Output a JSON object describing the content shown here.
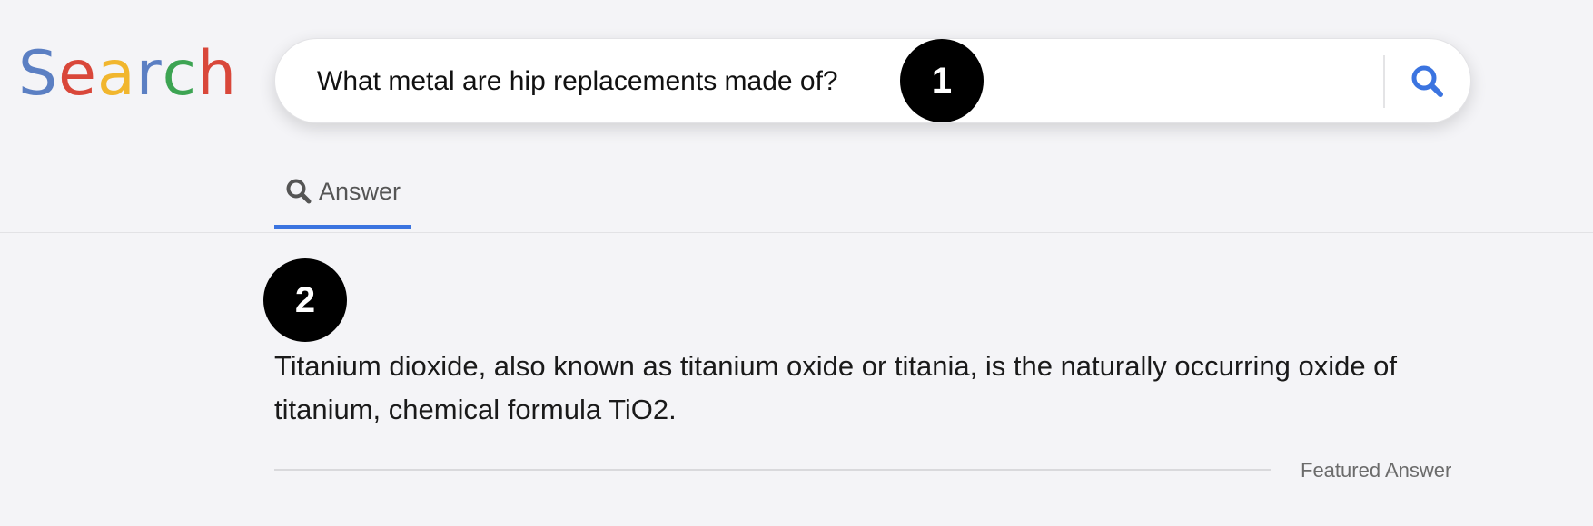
{
  "logo": {
    "letters": [
      {
        "char": "S",
        "color": "#5b7fc3"
      },
      {
        "char": "e",
        "color": "#d9473a"
      },
      {
        "char": "a",
        "color": "#f1b62e"
      },
      {
        "char": "r",
        "color": "#5b7fc3"
      },
      {
        "char": "c",
        "color": "#3da453"
      },
      {
        "char": "h",
        "color": "#d9473a"
      }
    ]
  },
  "search": {
    "query": "What metal are hip replacements made of?",
    "button_icon": "search-icon",
    "accent_color": "#3b74e0"
  },
  "markers": {
    "first": "1",
    "second": "2"
  },
  "tabs": {
    "answer": {
      "label": "Answer",
      "icon": "search-icon",
      "active": true
    }
  },
  "answer": {
    "text": "Titanium dioxide, also known as titanium oxide or titania, is the naturally occurring oxide of titanium, chemical formula TiO2.",
    "footer_label": "Featured Answer"
  }
}
